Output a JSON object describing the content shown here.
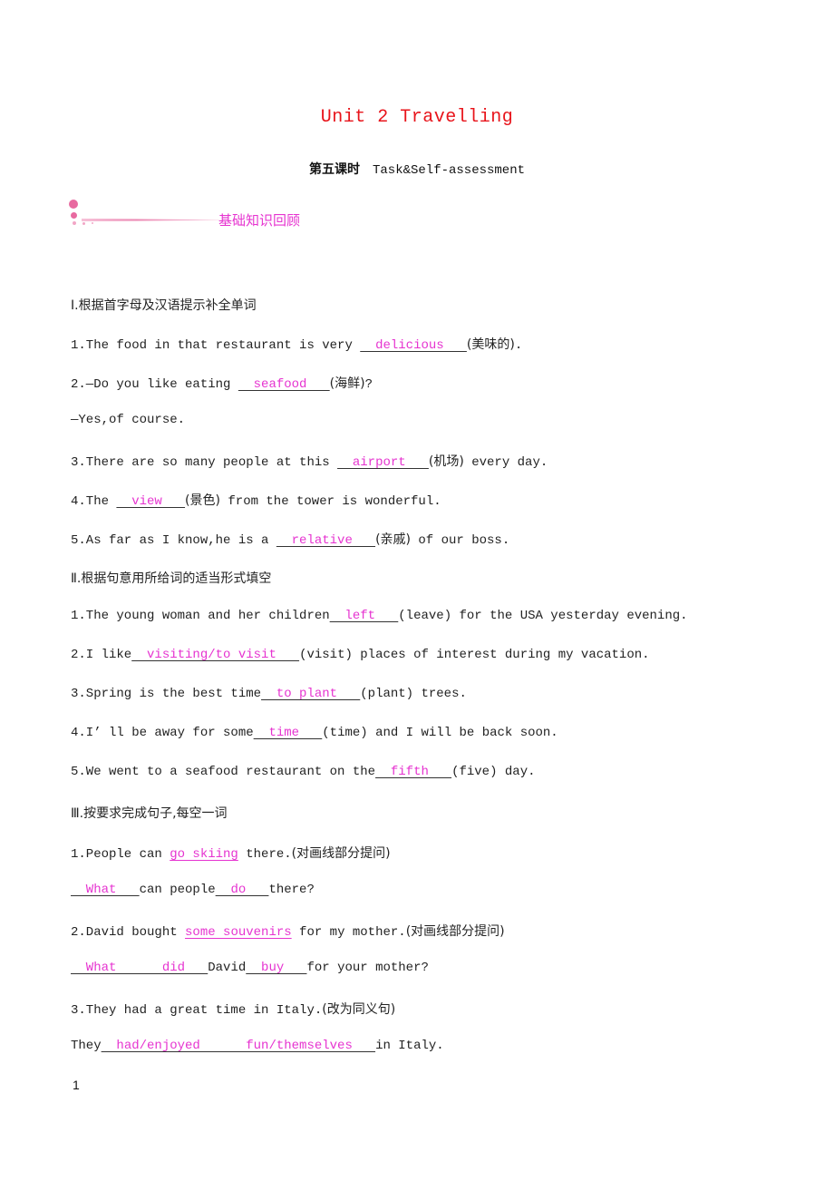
{
  "title": "Unit 2 Travelling",
  "subtitle": {
    "lesson": "第五课时",
    "topic": "Task&Self-assessment"
  },
  "banner": {
    "label": "基础知识回顾"
  },
  "section1": {
    "heading": "Ⅰ.根据首字母及汉语提示补全单词",
    "q1": {
      "pre": "1.The food in that restaurant is very ",
      "answer": "  delicious   ",
      "hint": "(美味的)",
      "post": "."
    },
    "q2": {
      "pre": "2.—Do you like eating ",
      "answer": "  seafood   ",
      "hint": "(海鲜)",
      "post": "?"
    },
    "q2b": "—Yes,of course.",
    "q3": {
      "pre": "3.There are so many people at this ",
      "answer": "  airport   ",
      "hint": "(机场)",
      "post": " every day."
    },
    "q4": {
      "pre": "4.The ",
      "answer": "  view   ",
      "hint": "(景色)",
      "post": " from the tower is wonderful."
    },
    "q5": {
      "pre": "5.As far as I know,he is a ",
      "answer": "  relative   ",
      "hint": "(亲戚)",
      "post": " of our boss."
    }
  },
  "section2": {
    "heading": "Ⅱ.根据句意用所给词的适当形式填空",
    "q1": {
      "pre": "1.The young woman and her children",
      "answer": "  left   ",
      "post": "(leave) for the USA yesterday evening."
    },
    "q2": {
      "pre": "2.I like",
      "answer": "  visiting/to visit   ",
      "post": "(visit) places of interest during my vacation."
    },
    "q3": {
      "pre": "3.Spring is the best time",
      "answer": "  to plant   ",
      "post": "(plant) trees."
    },
    "q4": {
      "pre": "4.I’ ll be away for some",
      "answer": "  time   ",
      "post": "(time) and I will be back soon."
    },
    "q5": {
      "pre": "5.We went to a seafood restaurant on the",
      "answer": "  fifth   ",
      "post": "(five) day."
    }
  },
  "section3": {
    "heading": "Ⅲ.按要求完成句子,每空一词",
    "q1": {
      "pre": "1.People can ",
      "underlined": "go skiing",
      "post": " there.",
      "instruction": "(对画线部分提问)",
      "a1": "  What   ",
      "mid": "can people",
      "a2": "  do   ",
      "end": "there?"
    },
    "q2": {
      "pre": "2.David bought ",
      "underlined": "some souvenirs",
      "post": " for my mother.",
      "instruction": "(对画线部分提问)",
      "a1": "  What      did   ",
      "mid": "David",
      "a2": "  buy   ",
      "end": "for your mother?"
    },
    "q3": {
      "pre": "3.They had a great time in Italy.",
      "instruction": "(改为同义句)",
      "start": "They",
      "a1": "  had/enjoyed      fun/themselves   ",
      "end": "in Italy."
    }
  },
  "page_number": "1"
}
